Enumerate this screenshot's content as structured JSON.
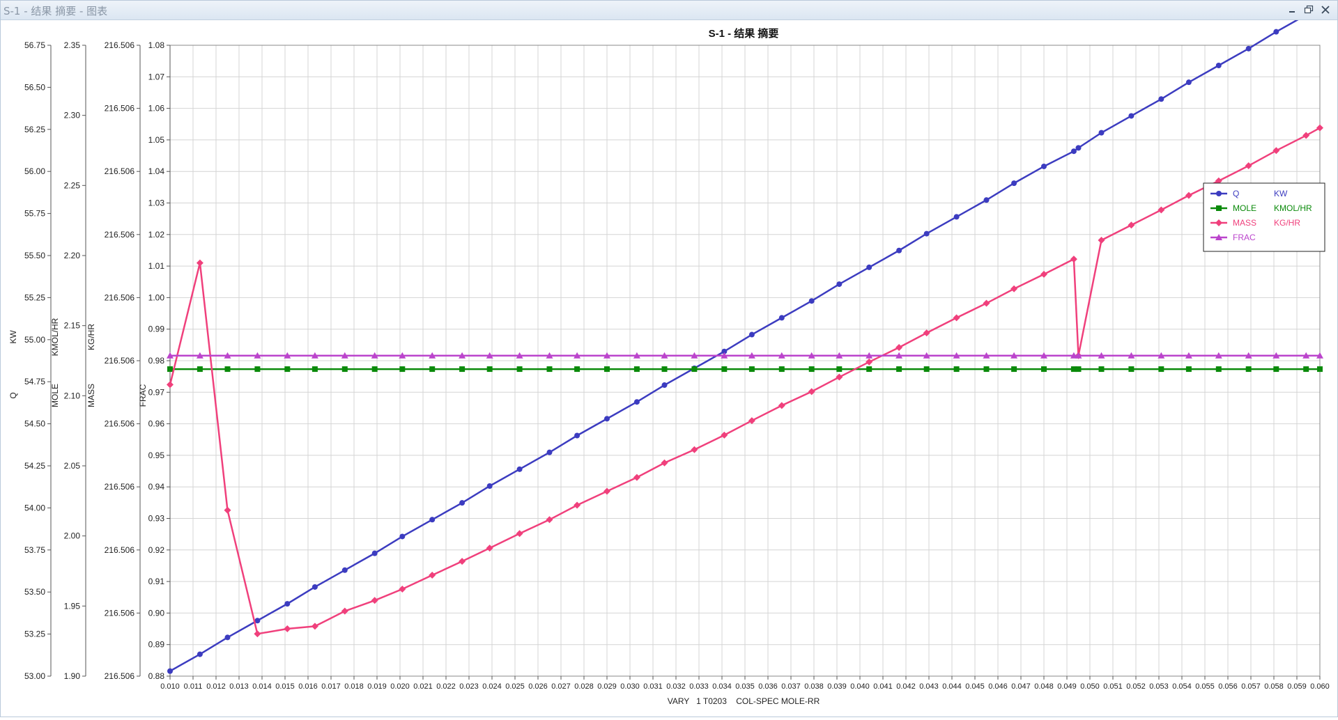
{
  "window": {
    "title": "S-1 - 结果 摘要 - 图表",
    "icons": [
      "minimize-icon",
      "restore-icon",
      "close-icon"
    ]
  },
  "chart_data": {
    "type": "line",
    "title": "S-1 - 结果 摘要",
    "xlabel": "VARY   1 T0203    COL-SPEC MOLE-RR",
    "x_ticks": [
      "0.010",
      "0.011",
      "0.012",
      "0.013",
      "0.014",
      "0.015",
      "0.016",
      "0.017",
      "0.018",
      "0.019",
      "0.020",
      "0.021",
      "0.022",
      "0.023",
      "0.024",
      "0.025",
      "0.026",
      "0.027",
      "0.028",
      "0.029",
      "0.030",
      "0.031",
      "0.032",
      "0.033",
      "0.034",
      "0.035",
      "0.036",
      "0.037",
      "0.038",
      "0.039",
      "0.040",
      "0.041",
      "0.042",
      "0.043",
      "0.044",
      "0.045",
      "0.046",
      "0.047",
      "0.048",
      "0.049",
      "0.050",
      "0.051",
      "0.052",
      "0.053",
      "0.054",
      "0.055",
      "0.056",
      "0.057",
      "0.058",
      "0.059",
      "0.060"
    ],
    "xlim": [
      0.01,
      0.06
    ],
    "grid": true,
    "legend_position": "right",
    "axes": [
      {
        "id": "q",
        "label_name": "Q",
        "label_unit": "KW",
        "ylim": [
          53.0,
          56.75
        ],
        "ticks": [
          "53.00",
          "53.25",
          "53.50",
          "53.75",
          "54.00",
          "54.25",
          "54.50",
          "54.75",
          "55.00",
          "55.25",
          "55.50",
          "55.75",
          "56.00",
          "56.25",
          "56.50",
          "56.75"
        ]
      },
      {
        "id": "mole",
        "label_name": "MOLE",
        "label_unit": "KMOL/HR",
        "ylim": [
          1.9,
          2.35
        ],
        "ticks": [
          "1.90",
          "1.95",
          "2.00",
          "2.05",
          "2.10",
          "2.15",
          "2.20",
          "2.25",
          "2.30",
          "2.35"
        ]
      },
      {
        "id": "mass",
        "label_name": "MASS",
        "label_unit": "KG/HR",
        "ylim": [
          0,
          10
        ],
        "ticks": [
          "216.506",
          "216.506",
          "216.506",
          "216.506",
          "216.506",
          "216.506",
          "216.506",
          "216.506",
          "216.506",
          "216.506",
          "216.506"
        ]
      },
      {
        "id": "frac",
        "label_name": "FRAC",
        "label_unit": "",
        "ylim": [
          0.88,
          1.08
        ],
        "ticks": [
          "0.88",
          "0.89",
          "0.90",
          "0.91",
          "0.92",
          "0.93",
          "0.94",
          "0.95",
          "0.96",
          "0.97",
          "0.98",
          "0.99",
          "1.00",
          "1.01",
          "1.02",
          "1.03",
          "1.04",
          "1.05",
          "1.06",
          "1.07",
          "1.08"
        ]
      }
    ],
    "series": [
      {
        "name": "Q",
        "unit": "KW",
        "axis": "q",
        "color": "#3c3cc0",
        "marker": "circle",
        "x": [
          0.01,
          0.0113,
          0.0125,
          0.0138,
          0.0151,
          0.0163,
          0.0176,
          0.0189,
          0.0201,
          0.0214,
          0.0227,
          0.0239,
          0.0252,
          0.0265,
          0.0277,
          0.029,
          0.0303,
          0.0315,
          0.0328,
          0.0341,
          0.0353,
          0.0366,
          0.0379,
          0.0391,
          0.0404,
          0.0417,
          0.0429,
          0.0442,
          0.0455,
          0.0467,
          0.048,
          0.0493,
          0.0495,
          0.0505,
          0.0518,
          0.0531,
          0.0543,
          0.0556,
          0.0569,
          0.0581,
          0.0594,
          0.06
        ],
        "y": [
          53.03,
          53.13,
          53.23,
          53.33,
          53.43,
          53.53,
          53.63,
          53.73,
          53.83,
          53.93,
          54.03,
          54.13,
          54.23,
          54.33,
          54.43,
          54.53,
          54.63,
          54.73,
          54.83,
          54.93,
          55.03,
          55.13,
          55.23,
          55.33,
          55.43,
          55.53,
          55.63,
          55.73,
          55.83,
          55.93,
          56.03,
          56.12,
          56.14,
          56.23,
          56.33,
          56.43,
          56.53,
          56.63,
          56.73,
          56.83,
          56.93,
          56.98
        ]
      },
      {
        "name": "MOLE",
        "unit": "KMOL/HR",
        "axis": "mole",
        "color": "#0a8a0a",
        "marker": "square",
        "x": [
          0.01,
          0.0113,
          0.0125,
          0.0138,
          0.0151,
          0.0163,
          0.0176,
          0.0189,
          0.0201,
          0.0214,
          0.0227,
          0.0239,
          0.0252,
          0.0265,
          0.0277,
          0.029,
          0.0303,
          0.0315,
          0.0328,
          0.0341,
          0.0353,
          0.0366,
          0.0379,
          0.0391,
          0.0404,
          0.0417,
          0.0429,
          0.0442,
          0.0455,
          0.0467,
          0.048,
          0.0493,
          0.0495,
          0.0505,
          0.0518,
          0.0531,
          0.0543,
          0.0556,
          0.0569,
          0.0581,
          0.0594,
          0.06
        ],
        "y": [
          2.119,
          2.119,
          2.119,
          2.119,
          2.119,
          2.119,
          2.119,
          2.119,
          2.119,
          2.119,
          2.119,
          2.119,
          2.119,
          2.119,
          2.119,
          2.119,
          2.119,
          2.119,
          2.119,
          2.119,
          2.119,
          2.119,
          2.119,
          2.119,
          2.119,
          2.119,
          2.119,
          2.119,
          2.119,
          2.119,
          2.119,
          2.119,
          2.119,
          2.119,
          2.119,
          2.119,
          2.119,
          2.119,
          2.119,
          2.119,
          2.119,
          2.119
        ]
      },
      {
        "name": "MASS",
        "unit": "KG/HR",
        "axis": "mass",
        "color": "#f0407c",
        "marker": "diamond",
        "x": [
          0.01,
          0.0113,
          0.0125,
          0.0138,
          0.0151,
          0.0163,
          0.0176,
          0.0189,
          0.0201,
          0.0214,
          0.0227,
          0.0239,
          0.0252,
          0.0265,
          0.0277,
          0.029,
          0.0303,
          0.0315,
          0.0328,
          0.0341,
          0.0353,
          0.0366,
          0.0379,
          0.0391,
          0.0404,
          0.0417,
          0.0429,
          0.0442,
          0.0455,
          0.0467,
          0.048,
          0.0493,
          0.0495,
          0.0505,
          0.0518,
          0.0531,
          0.0543,
          0.0556,
          0.0569,
          0.0581,
          0.0594,
          0.06
        ],
        "y": [
          4.62,
          6.55,
          2.63,
          0.67,
          0.75,
          0.79,
          1.03,
          1.2,
          1.38,
          1.6,
          1.82,
          2.03,
          2.26,
          2.48,
          2.71,
          2.93,
          3.15,
          3.38,
          3.59,
          3.82,
          4.05,
          4.29,
          4.51,
          4.74,
          4.98,
          5.21,
          5.44,
          5.68,
          5.91,
          6.14,
          6.37,
          6.61,
          5.08,
          6.91,
          7.15,
          7.39,
          7.62,
          7.85,
          8.09,
          8.33,
          8.57,
          8.69
        ]
      },
      {
        "name": "FRAC",
        "unit": "",
        "axis": "frac",
        "color": "#bb44cc",
        "marker": "triangle",
        "x": [
          0.01,
          0.0113,
          0.0125,
          0.0138,
          0.0151,
          0.0163,
          0.0176,
          0.0189,
          0.0201,
          0.0214,
          0.0227,
          0.0239,
          0.0252,
          0.0265,
          0.0277,
          0.029,
          0.0303,
          0.0315,
          0.0328,
          0.0341,
          0.0353,
          0.0366,
          0.0379,
          0.0391,
          0.0404,
          0.0417,
          0.0429,
          0.0442,
          0.0455,
          0.0467,
          0.048,
          0.0493,
          0.0495,
          0.0505,
          0.0518,
          0.0531,
          0.0543,
          0.0556,
          0.0569,
          0.0581,
          0.0594,
          0.06
        ],
        "y": [
          0.9816,
          0.9816,
          0.9816,
          0.9816,
          0.9816,
          0.9816,
          0.9816,
          0.9816,
          0.9816,
          0.9816,
          0.9816,
          0.9816,
          0.9816,
          0.9816,
          0.9816,
          0.9816,
          0.9816,
          0.9816,
          0.9816,
          0.9816,
          0.9816,
          0.9816,
          0.9816,
          0.9816,
          0.9816,
          0.9816,
          0.9816,
          0.9816,
          0.9816,
          0.9816,
          0.9816,
          0.9816,
          0.9816,
          0.9816,
          0.9816,
          0.9816,
          0.9816,
          0.9816,
          0.9816,
          0.9816,
          0.9816,
          0.9816
        ]
      }
    ]
  }
}
